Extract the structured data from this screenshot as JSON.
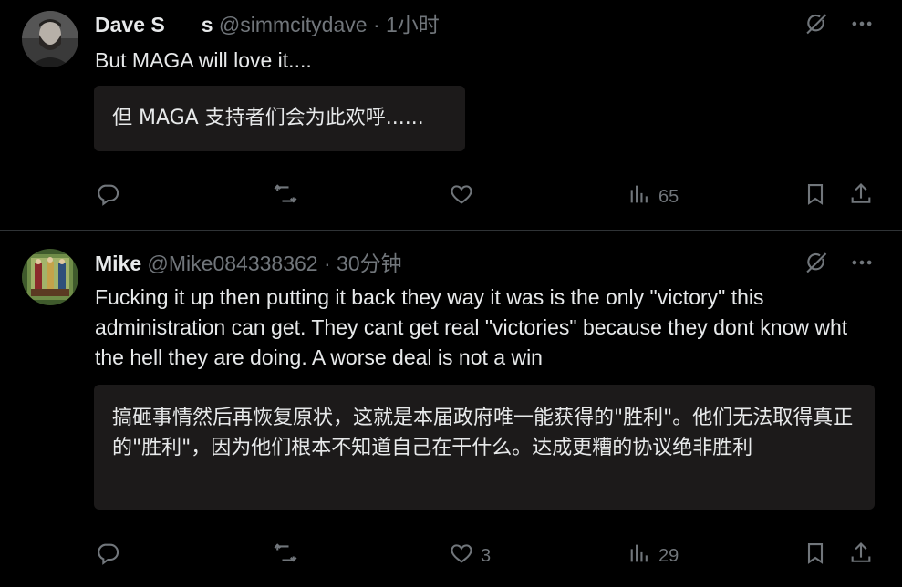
{
  "tweets": [
    {
      "name": "Dave S",
      "name_obscured_suffix": "s",
      "handle": "@simmcitydave",
      "dot": "·",
      "time": "1小时",
      "text": "But MAGA will love it....",
      "translation": "但 MAGA 支持者们会为此欢呼......",
      "counts": {
        "replies": "",
        "retweets": "",
        "likes": "",
        "views": "65"
      }
    },
    {
      "name": "Mike",
      "handle": "@Mike084338362",
      "dot": "·",
      "time": "30分钟",
      "text": "Fucking it up then putting it back they way it was is the only \"victory\" this administration can get. They cant get real \"victories\" because they dont know wht the hell they are doing. A worse deal is not a win",
      "translation": "搞砸事情然后再恢复原状，这就是本届政府唯一能获得的\"胜利\"。他们无法取得真正的\"胜利\"，因为他们根本不知道自己在干什么。达成更糟的协议绝非胜利",
      "counts": {
        "replies": "",
        "retweets": "",
        "likes": "3",
        "views": "29"
      }
    }
  ],
  "icons": {
    "grok": "grok-icon",
    "more": "more-icon",
    "reply": "reply-icon",
    "retweet": "retweet-icon",
    "like": "heart-icon",
    "views": "views-icon",
    "bookmark": "bookmark-icon",
    "share": "share-icon"
  },
  "colors": {
    "background": "#000000",
    "text": "#e7e9ea",
    "muted": "#71767b",
    "divider": "#2f3336",
    "translation_bg": "#1c1a1a"
  }
}
